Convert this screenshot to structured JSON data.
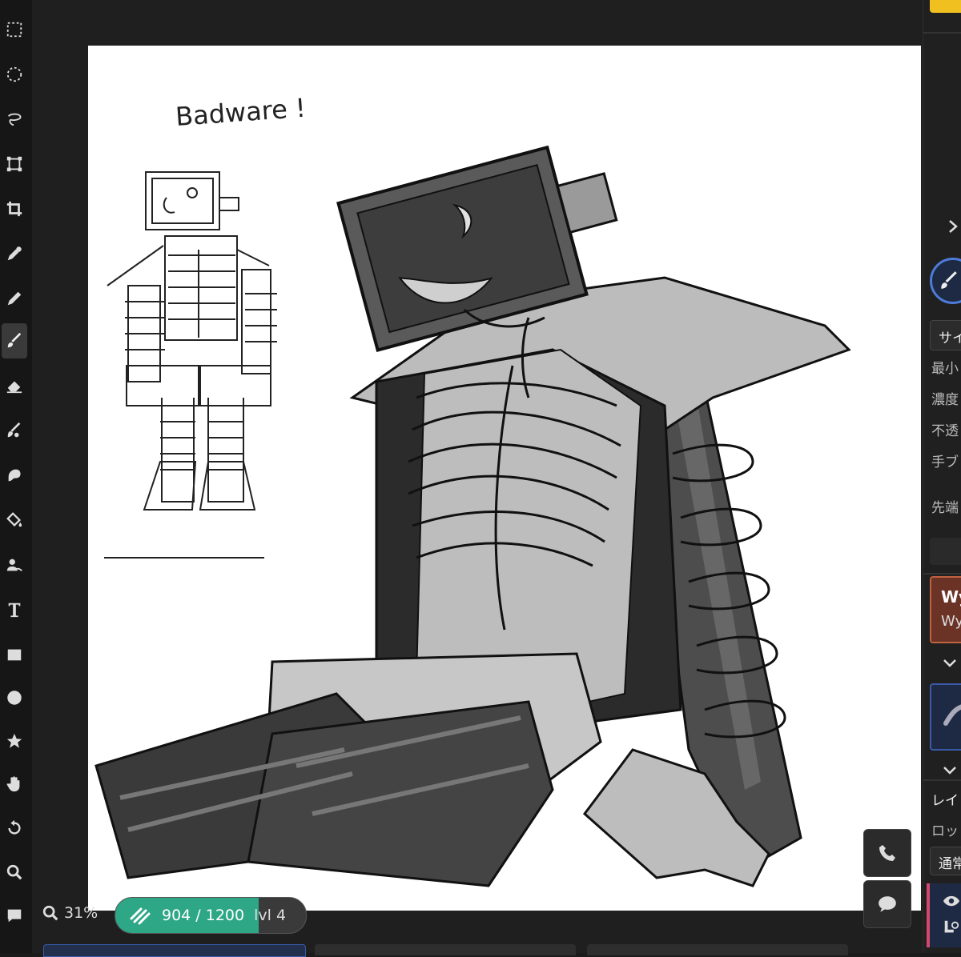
{
  "toolbar": {
    "tools": [
      {
        "name": "rect-select",
        "icon": "rect-select-icon"
      },
      {
        "name": "ellipse-select",
        "icon": "ellipse-select-icon"
      },
      {
        "name": "lasso",
        "icon": "lasso-icon"
      },
      {
        "name": "transform",
        "icon": "transform-icon"
      },
      {
        "name": "crop",
        "icon": "crop-icon"
      },
      {
        "name": "eyedropper",
        "icon": "eyedropper-icon"
      },
      {
        "name": "pen",
        "icon": "pen-icon"
      },
      {
        "name": "brush",
        "icon": "brush-icon",
        "active": true
      },
      {
        "name": "eraser",
        "icon": "eraser-icon"
      },
      {
        "name": "blend",
        "icon": "blend-icon"
      },
      {
        "name": "smudge",
        "icon": "smudge-icon"
      },
      {
        "name": "fill",
        "icon": "fill-bucket-icon"
      },
      {
        "name": "clone",
        "icon": "clone-icon"
      },
      {
        "name": "text",
        "icon": "text-icon"
      },
      {
        "name": "rectangle",
        "icon": "rectangle-icon"
      },
      {
        "name": "ellipse",
        "icon": "ellipse-icon"
      },
      {
        "name": "star",
        "icon": "star-icon"
      },
      {
        "name": "hand",
        "icon": "hand-icon"
      },
      {
        "name": "rotate",
        "icon": "rotate-icon"
      },
      {
        "name": "zoom",
        "icon": "zoom-icon"
      },
      {
        "name": "comment",
        "icon": "comment-icon"
      }
    ]
  },
  "canvas": {
    "sketch_text": "Badware !"
  },
  "status": {
    "zoom": "31%",
    "xp_current": 904,
    "xp_max": 1200,
    "xp_text": "904 / 1200",
    "level": "lvl 4",
    "xp_color": "#2ea787"
  },
  "side_panel": {
    "brush_size_label": "サイ",
    "min_label": "最小",
    "density_label": "濃度",
    "opacity_label": "不透",
    "stabilizer_label": "手ブ",
    "tip_label": "先端",
    "card_title": "Wy",
    "card_subtitle": "Wy",
    "layer_label": "レイ",
    "lock_label": "ロッ",
    "blend_mode": "通常"
  }
}
